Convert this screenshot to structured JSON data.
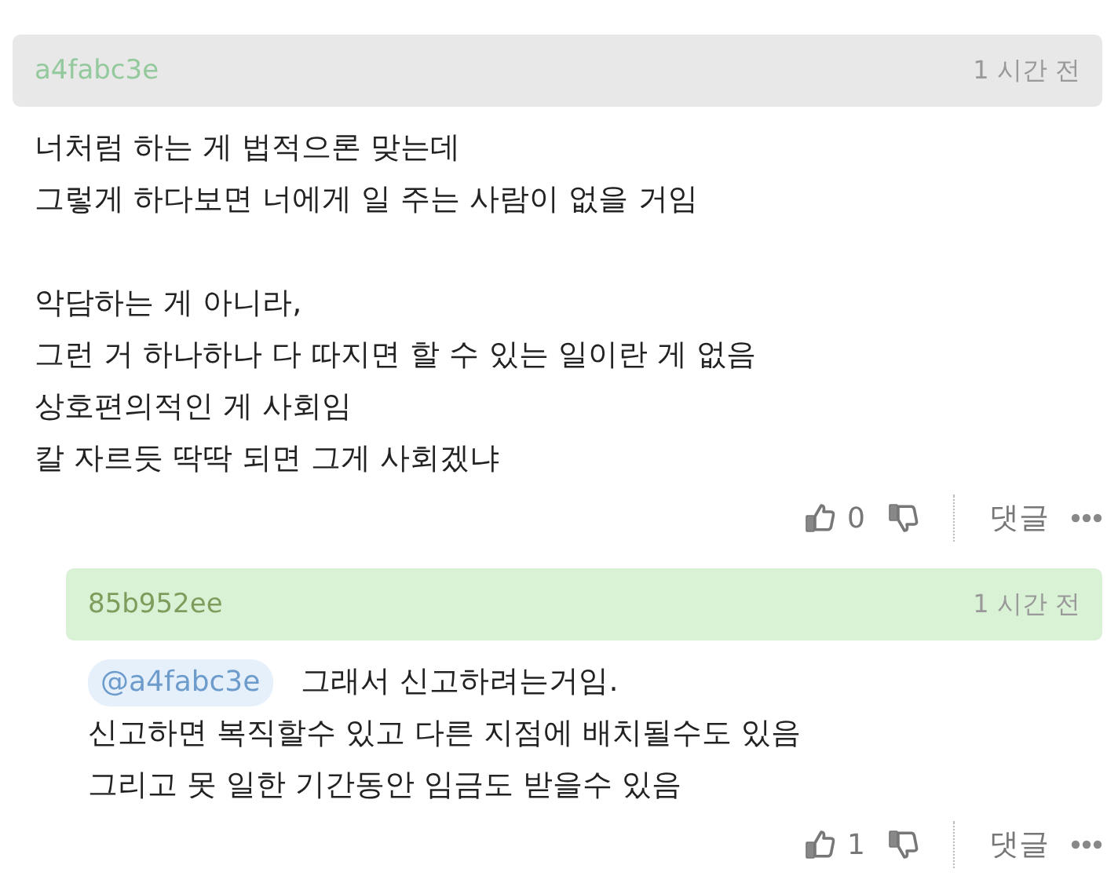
{
  "comments": [
    {
      "author": "a4fabc3e",
      "time": "1 시간 전",
      "kind": "comment",
      "paragraphs": [
        [
          "너처럼 하는 게 법적으론 맞는데",
          "그렇게 하다보면 너에게 일 주는 사람이 없을 거임"
        ],
        [
          "악담하는 게 아니라,",
          "그런 거 하나하나 다 따지면 할 수 있는 일이란 게 없음",
          "상호편의적인 게 사회임",
          "칼 자르듯 딱딱 되면 그게 사회겠냐"
        ]
      ],
      "likes": "0",
      "reply_label": "댓글"
    },
    {
      "author": "85b952ee",
      "time": "1 시간 전",
      "kind": "reply",
      "mention": "@a4fabc3e",
      "paragraphs": [
        [
          "그래서 신고하려는거임.",
          "신고하면 복직할수 있고 다른 지점에 배치될수도 있음",
          "그리고 못 일한 기간동안 임금도 받을수 있음"
        ]
      ],
      "likes": "1",
      "reply_label": "댓글"
    }
  ]
}
